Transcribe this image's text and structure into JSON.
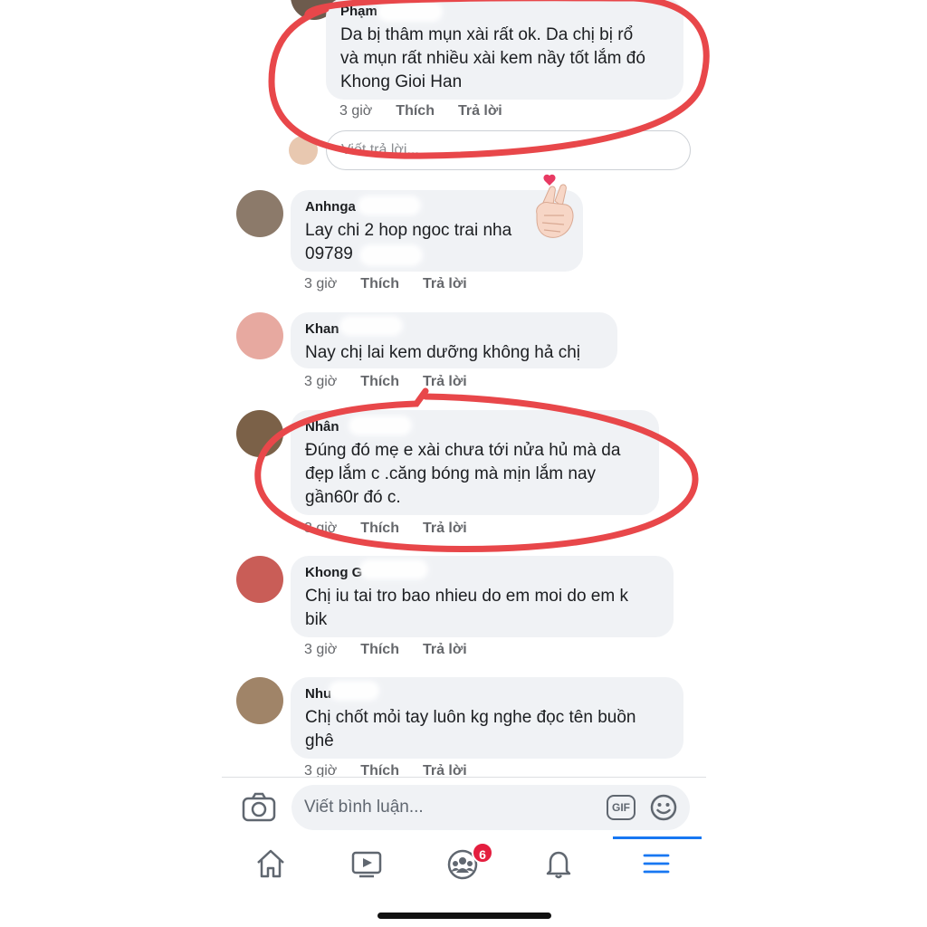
{
  "comments": [
    {
      "author": "Phạm",
      "text": "Da bị thâm mụn xài rất ok. Da chị bị rổ\nvà mụn rất nhiều xài kem nầy tốt lắm đó\nKhong Gioi Han",
      "time": "3 giờ",
      "like": "Thích",
      "reply": "Trả lời"
    },
    {
      "author": "Anhnga",
      "text": "Lay chi 2 hop ngoc trai nha\n09789",
      "time": "3 giờ",
      "like": "Thích",
      "reply": "Trả lời"
    },
    {
      "author": "Khan",
      "text": "Nay chị lai kem dưỡng không hả chị",
      "time": "3 giờ",
      "like": "Thích",
      "reply": "Trả lời"
    },
    {
      "author": "Nhân",
      "text": "Đúng đó mẹ e xài chưa tới nửa hủ mà da\nđẹp lắm c .căng bóng mà mịn lắm nay\ngần60r đó c.",
      "time": "3 giờ",
      "like": "Thích",
      "reply": "Trả lời"
    },
    {
      "author": "Khong G",
      "text": "Chị iu tai tro bao nhieu do em moi do em k\nbik",
      "time": "3 giờ",
      "like": "Thích",
      "reply": "Trả lời"
    },
    {
      "author": "Nhu",
      "text": "Chị chốt mỏi tay luôn kg nghe đọc tên buồn\nghê",
      "time": "3 giờ",
      "like": "Thích",
      "reply": "Trả lời"
    }
  ],
  "reply_input": {
    "placeholder": "Viết trả lời..."
  },
  "composer": {
    "placeholder": "Viết bình luận...",
    "gif_label": "GIF"
  },
  "nav": {
    "items": [
      "home-icon",
      "video-icon",
      "groups-icon",
      "bell-icon",
      "menu-icon"
    ],
    "groups_badge": "6",
    "active": "menu-icon"
  },
  "colors": {
    "bubble": "#f0f2f5",
    "accent": "#1877f2",
    "badge": "#e41e3f",
    "marker": "#e8474a"
  }
}
